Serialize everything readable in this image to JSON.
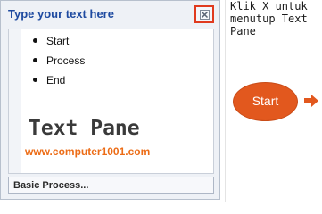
{
  "text_pane": {
    "title": "Type your text here",
    "close_icon": "close-x-icon",
    "bullets": [
      "Start",
      "Process",
      "End"
    ],
    "overlay_label": "Text Pane",
    "website": "www.computer1001.com",
    "footer_label": "Basic Process..."
  },
  "canvas": {
    "hint_lines": [
      "Klik X untuk",
      "menutup Text",
      "Pane"
    ],
    "shape_label": "Start",
    "arrow_icon": "right-arrow-icon"
  },
  "colors": {
    "title_blue": "#1e4aa0",
    "close_highlight": "#e03a1e",
    "accent_orange": "#e2581e",
    "website_orange": "#ec6c16"
  }
}
